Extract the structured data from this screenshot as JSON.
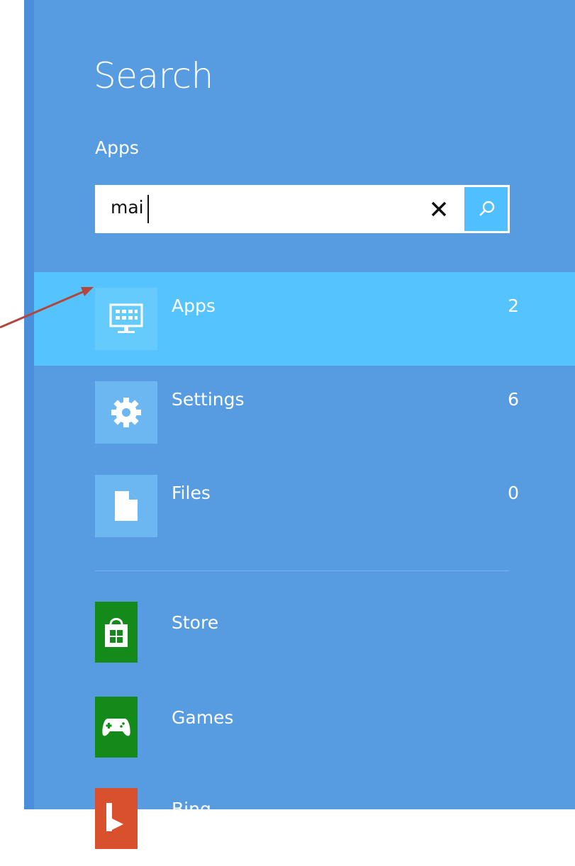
{
  "search": {
    "title": "Search",
    "scope": "Apps",
    "query": "mai"
  },
  "categories": [
    {
      "label": "Apps",
      "count": "2",
      "icon": "apps-icon",
      "selected": true
    },
    {
      "label": "Settings",
      "count": "6",
      "icon": "gear-icon",
      "selected": false
    },
    {
      "label": "Files",
      "count": "0",
      "icon": "file-icon",
      "selected": false
    }
  ],
  "apps": [
    {
      "label": "Store",
      "icon": "store-icon",
      "color": "#138a1a"
    },
    {
      "label": "Games",
      "icon": "gamepad-icon",
      "color": "#138a1a"
    },
    {
      "label": "Bing",
      "icon": "bing-icon",
      "color": "#d9512c"
    }
  ],
  "colors": {
    "pane": "#579be0",
    "selected_row": "#54c3fe",
    "search_button": "#4fbfff",
    "annotation_arrow": "#b3463f"
  }
}
